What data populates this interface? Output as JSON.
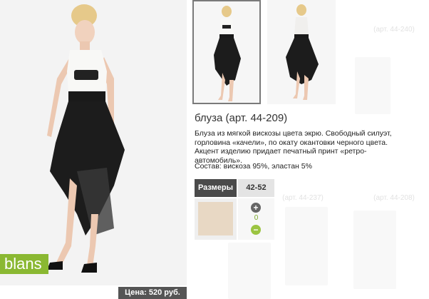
{
  "product": {
    "title": "блуза (арт. 44-209)",
    "description": "Блуза из мягкой вискозы цвета экрю. Свободный силуэт, горловина «качели», по окату окантовки черного цвета. Акцент изделию придает печатный принт «ретро-автомобиль».",
    "composition": "Состав: вискоза 95%, эластан 5%",
    "price": "Цена: 520 руб.",
    "brand": "blans"
  },
  "size_table": {
    "header_label": "Размеры",
    "header_value": "42-52",
    "quantity": "0",
    "plus_label": "+",
    "minus_label": "−",
    "swatch_color": "#e8d8c4"
  },
  "thumbnails": [
    {
      "name": "front-view",
      "selected": true
    },
    {
      "name": "back-view",
      "selected": false
    }
  ],
  "background_items": [
    {
      "caption": "(арт. 44-240)"
    },
    {
      "caption": "(арт. 44-237)"
    },
    {
      "caption": "(арт. 44-208)"
    }
  ],
  "colors": {
    "brand_green": "#8ab832",
    "price_bg": "#555555",
    "header_dark": "#4a4a4a"
  }
}
